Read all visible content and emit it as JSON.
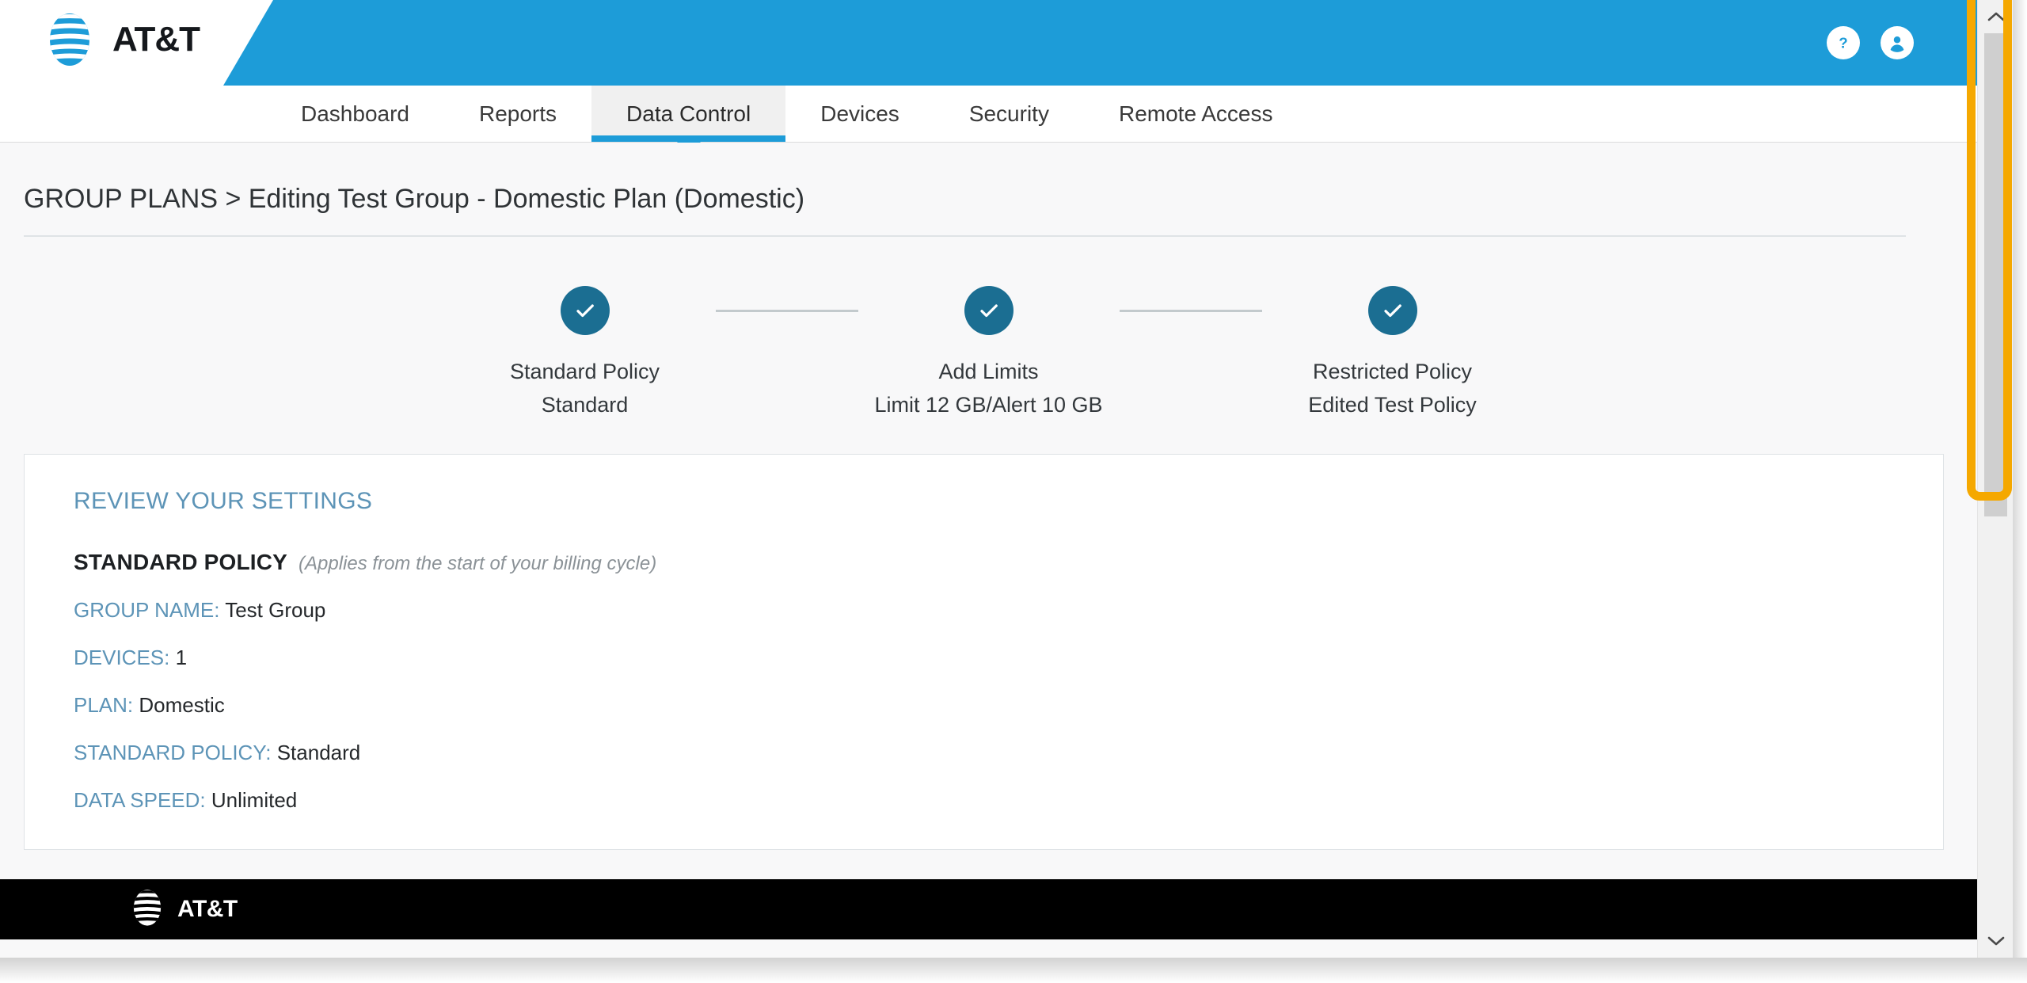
{
  "brand": {
    "name": "AT&T",
    "header_blue": "#1d9cd8",
    "step_blue": "#1b6e92",
    "accent_label": "#5d94b7",
    "highlight_orange": "#f5a800"
  },
  "header": {
    "logo_text": "AT&T",
    "help_icon": "help-circle-icon",
    "account_icon": "user-account-icon"
  },
  "nav": {
    "tabs": [
      {
        "label": "Dashboard",
        "active": false
      },
      {
        "label": "Reports",
        "active": false
      },
      {
        "label": "Data Control",
        "active": true
      },
      {
        "label": "Devices",
        "active": false
      },
      {
        "label": "Security",
        "active": false
      },
      {
        "label": "Remote Access",
        "active": false
      }
    ]
  },
  "breadcrumb": {
    "text": "GROUP PLANS > Editing Test Group - Domestic Plan (Domestic)"
  },
  "stepper": {
    "steps": [
      {
        "title": "Standard Policy",
        "subtitle": "Standard",
        "state": "complete",
        "icon": "check-icon"
      },
      {
        "title": "Add Limits",
        "subtitle": "Limit 12 GB/Alert 10 GB",
        "state": "complete",
        "icon": "check-icon"
      },
      {
        "title": "Restricted Policy",
        "subtitle": "Edited Test Policy",
        "state": "complete",
        "icon": "check-icon"
      }
    ]
  },
  "review": {
    "title": "REVIEW YOUR SETTINGS",
    "policy_heading": "STANDARD POLICY",
    "policy_note": "(Applies from the start of your billing cycle)",
    "rows": [
      {
        "key": "GROUP NAME:",
        "value": "Test Group"
      },
      {
        "key": "DEVICES:",
        "value": "1"
      },
      {
        "key": "PLAN:",
        "value": "Domestic"
      },
      {
        "key": "STANDARD POLICY:",
        "value": "Standard"
      },
      {
        "key": "DATA SPEED:",
        "value": "Unlimited"
      }
    ]
  },
  "footer": {
    "logo_text": "AT&T"
  },
  "scrollbar": {
    "up_arrow_icon": "chevron-up-icon",
    "down_arrow_icon": "chevron-down-icon",
    "thumb": "scrollbar-thumb"
  }
}
